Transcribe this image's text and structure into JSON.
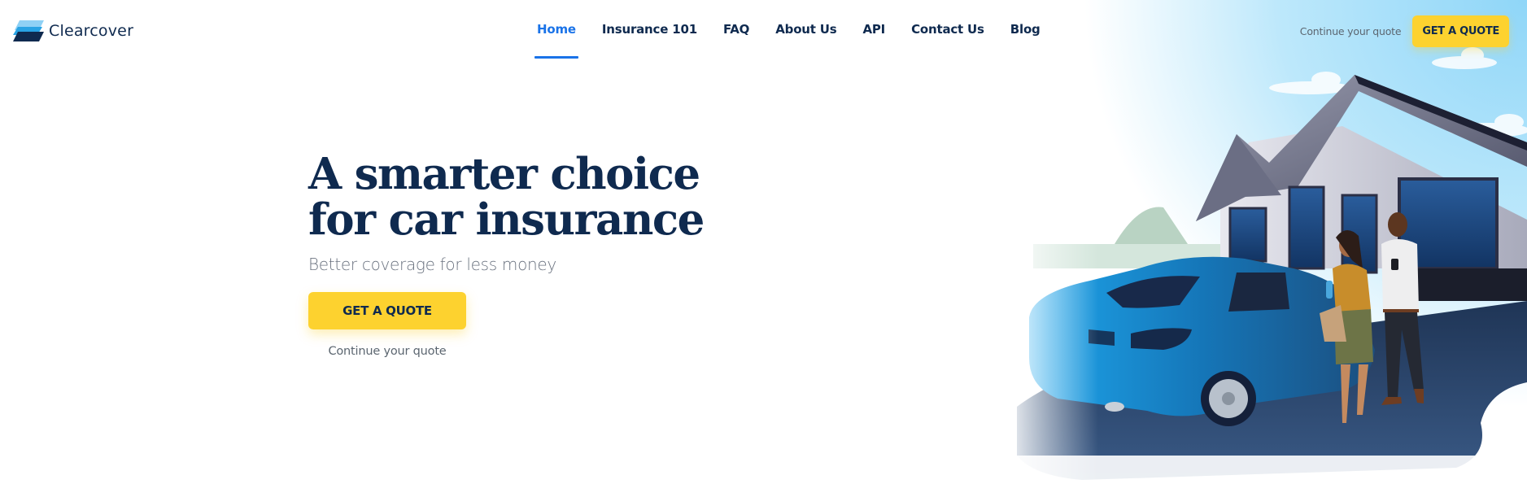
{
  "brand": {
    "name": "Clearcover",
    "colors": {
      "navy": "#0f2a4f",
      "accent_blue": "#1a73e8",
      "cta_yellow": "#fdd22f",
      "muted_text": "#5c6670"
    }
  },
  "header": {
    "logo_icon": "clearcover-logo-icon",
    "nav": [
      {
        "label": "Home",
        "active": true
      },
      {
        "label": "Insurance 101",
        "active": false
      },
      {
        "label": "FAQ",
        "active": false
      },
      {
        "label": "About Us",
        "active": false
      },
      {
        "label": "API",
        "active": false
      },
      {
        "label": "Contact Us",
        "active": false
      },
      {
        "label": "Blog",
        "active": false
      }
    ],
    "continue_quote_label": "Continue your quote",
    "get_quote_label": "GET A QUOTE"
  },
  "hero": {
    "title_line1": "A smarter choice",
    "title_line2": "for car insurance",
    "subtitle": "Better coverage for less money",
    "get_quote_label": "GET A QUOTE",
    "continue_quote_label": "Continue your quote",
    "illustration": "illustration of a couple standing by a blue sedan in front of a house under a blue sky"
  }
}
